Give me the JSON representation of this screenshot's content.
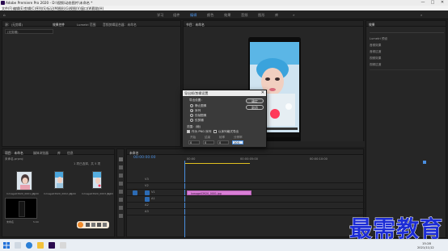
{
  "window": {
    "title": "Adobe Premiere Pro 2020 - D:\\视频\\动态图片\\未命名 *",
    "minimize": "—",
    "maximize": "□",
    "close": "✕"
  },
  "menu": [
    "文件(F)",
    "编辑(E)",
    "剪辑(C)",
    "序列(S)",
    "标记(M)",
    "图形(G)",
    "视图(V)",
    "窗口(W)",
    "帮助(H)"
  ],
  "workspaces": [
    "学习",
    "组件",
    "编辑",
    "颜色",
    "效果",
    "音频",
    "图形",
    "库"
  ],
  "workspace_active": "编辑",
  "source_panel": {
    "tabs": [
      "源：(无剪辑)",
      "效果控件",
      "Lumetri 范围",
      "音频剪辑混合器：未命名"
    ],
    "inner_label": "(无剪辑)"
  },
  "program_panel": {
    "tab": "节目：未命名"
  },
  "project_panel": {
    "tabs": [
      "项目：未命名",
      "媒体浏览器",
      "库",
      "信息"
    ],
    "filename": "未命名.prproj",
    "items": [
      {
        "name": "Inmage03920_0001.jpg",
        "dur": "5:00"
      },
      {
        "name": "Inmage03920_0002.jpg",
        "dur": "5:00"
      },
      {
        "name": "Inmage03920_0003.jpg",
        "dur": "5:00"
      },
      {
        "name": "未命名",
        "dur": "5:00"
      }
    ],
    "item_count": "1 项已选择，共 5 项"
  },
  "timeline": {
    "tab": "未命名",
    "timecode": "00:00:00:00",
    "ruler": [
      "00:00",
      "00:00:05:00",
      "00:00:10:00"
    ],
    "clip_label": "Inmage03920_0001.jpg",
    "tracks": [
      "V3",
      "V2",
      "V1",
      "A1",
      "A2",
      "A3"
    ]
  },
  "dialog": {
    "title": "导出帧/剪辑设置",
    "close": "✕",
    "section_label": "导出设置：",
    "options": [
      {
        "label": "静止图像",
        "checked": false
      },
      {
        "label": "序列",
        "checked": true
      },
      {
        "label": "仅帧图像",
        "checked": false
      },
      {
        "label": "仅剪辑",
        "checked": false
      }
    ],
    "ok": "确定",
    "cancel": "取消",
    "range_label": "范围：(帧)",
    "check1": {
      "label": "作为 PNG 序列",
      "checked": true
    },
    "check2": {
      "label": "以序列格式导出",
      "checked": false
    },
    "fields": [
      "开始",
      "结束",
      "帧率",
      "分辨率"
    ],
    "field_values": [
      "0",
      "0",
      "0",
      "100"
    ]
  },
  "right_panel": {
    "tab": "效果",
    "lines": [
      "Lumetri 预设",
      "音频效果",
      "音频过渡",
      "视频效果",
      "视频过渡"
    ]
  },
  "taskbar": {
    "time": "15:28",
    "date": "2021/11/12"
  },
  "watermark": "最需教育",
  "colors": {
    "accent": "#4a8fe0",
    "clip": "#d97fd6",
    "playhead": "#4a8fe0",
    "watermark": "#1c2cd6"
  }
}
